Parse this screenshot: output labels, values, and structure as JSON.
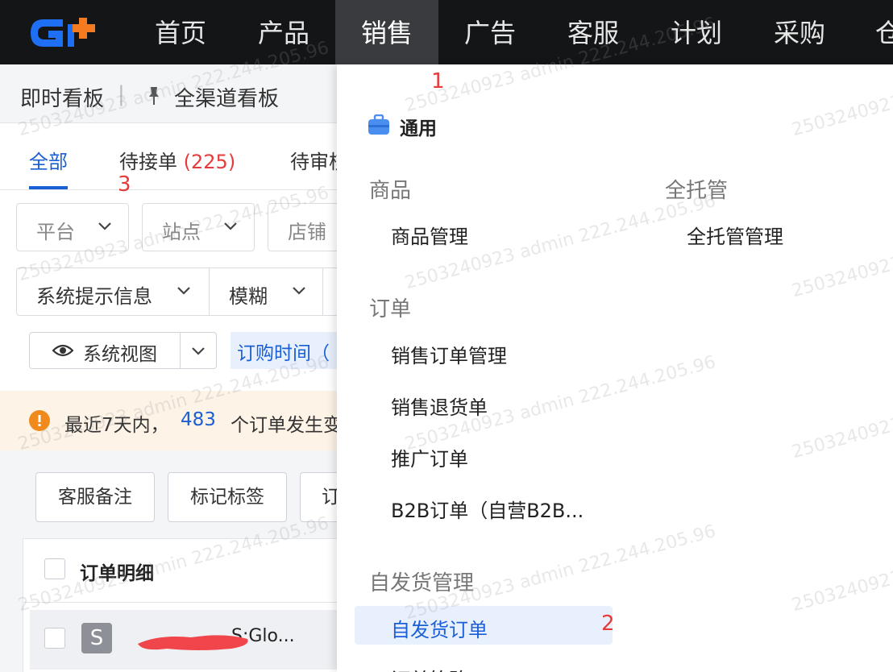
{
  "nav": {
    "items": [
      "首页",
      "产品",
      "销售",
      "广告",
      "客服",
      "计划",
      "采购",
      "仓"
    ],
    "active": "销售"
  },
  "breadcrumb": {
    "item1": "即时看板",
    "separator": "|",
    "item2": "全渠道看板"
  },
  "tabs": {
    "all": "全部",
    "pending": "待接单",
    "pending_count": "(225)",
    "review": "待审核"
  },
  "filters": {
    "platform": "平台",
    "site": "站点",
    "store": "店铺",
    "system_msg": "系统提示信息",
    "fuzzy": "模糊"
  },
  "view": {
    "label": "系统视图",
    "time_chip": "订购时间（"
  },
  "notice": {
    "prefix": "最近7天内，",
    "count": "483",
    "suffix": "个订单发生变"
  },
  "actions": {
    "cs_note": "客服备注",
    "mark_tag": "标记标签",
    "third": "订"
  },
  "table": {
    "header": "订单明细",
    "row": {
      "badge": "S",
      "text": "S:Glo..."
    }
  },
  "menu": {
    "general_label": "通用",
    "sections": {
      "goods": {
        "title": "商品",
        "items": [
          "商品管理"
        ]
      },
      "full_hosting": {
        "title": "全托管",
        "items": [
          "全托管管理"
        ]
      },
      "orders": {
        "title": "订单",
        "items": [
          "销售订单管理",
          "销售退货单",
          "推广订单",
          "B2B订单（自营B2B..."
        ]
      },
      "self_ship": {
        "title": "自发货管理",
        "items": [
          "自发货订单",
          "订单策略"
        ]
      }
    }
  },
  "annotations": {
    "one": "1",
    "two": "2",
    "three": "3"
  },
  "watermark": "2503240923 admin 222.244.205.96",
  "colors": {
    "accent": "#1a5fd6",
    "alert": "#e63b3b",
    "nav_bg": "#141517"
  }
}
